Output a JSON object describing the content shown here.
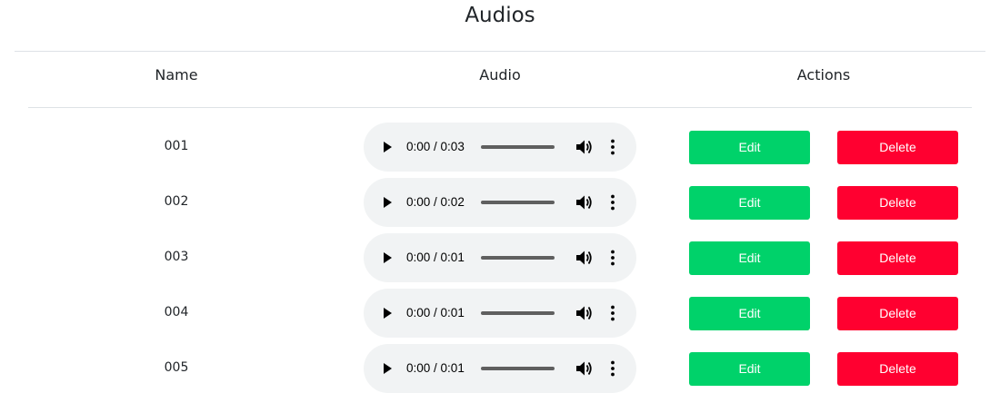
{
  "page": {
    "title": "Audios"
  },
  "table": {
    "headers": {
      "name": "Name",
      "audio": "Audio",
      "actions": "Actions"
    },
    "rows": [
      {
        "name": "001",
        "current_time": "0:00",
        "duration": "0:03",
        "edit_label": "Edit",
        "delete_label": "Delete"
      },
      {
        "name": "002",
        "current_time": "0:00",
        "duration": "0:02",
        "edit_label": "Edit",
        "delete_label": "Delete"
      },
      {
        "name": "003",
        "current_time": "0:00",
        "duration": "0:01",
        "edit_label": "Edit",
        "delete_label": "Delete"
      },
      {
        "name": "004",
        "current_time": "0:00",
        "duration": "0:01",
        "edit_label": "Edit",
        "delete_label": "Delete"
      },
      {
        "name": "005",
        "current_time": "0:00",
        "duration": "0:01",
        "edit_label": "Edit",
        "delete_label": "Delete"
      }
    ]
  },
  "player": {
    "time_separator": " / ",
    "icons": {
      "play": "play-icon",
      "volume": "volume-icon",
      "more": "more-vertical-icon"
    }
  },
  "colors": {
    "edit_button": "#00d26a",
    "delete_button": "#ff0030",
    "player_background": "#f1f3f4",
    "divider": "#dee2e6"
  }
}
